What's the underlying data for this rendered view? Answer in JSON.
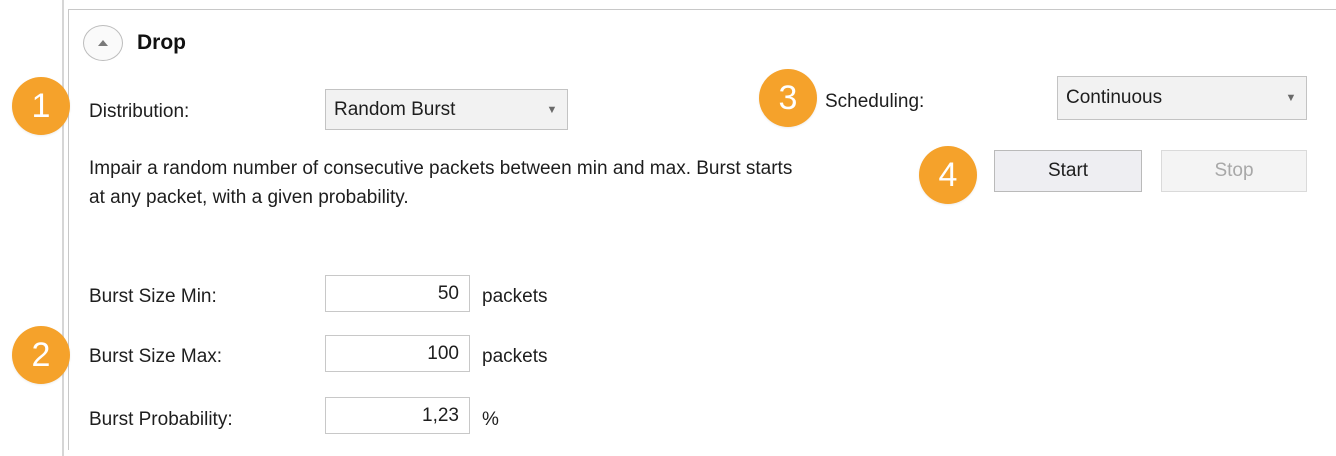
{
  "section": {
    "title": "Drop",
    "toggle_icon": "chevron-up-icon"
  },
  "distribution": {
    "label": "Distribution:",
    "value": "Random Burst"
  },
  "scheduling": {
    "label": "Scheduling:",
    "value": "Continuous"
  },
  "description": "Impair a random number of consecutive packets between min and max. Burst starts at any packet, with a given probability.",
  "fields": [
    {
      "label": "Burst Size Min:",
      "value": "50",
      "unit": "packets"
    },
    {
      "label": "Burst Size Max:",
      "value": "100",
      "unit": "packets"
    },
    {
      "label": "Burst Probability:",
      "value": "1,23",
      "unit": "%"
    }
  ],
  "buttons": {
    "start": "Start",
    "stop": "Stop"
  },
  "callouts": [
    "1",
    "2",
    "3",
    "4"
  ],
  "colors": {
    "callout": "#f5a22b",
    "disabled_text": "#a8a8a8"
  }
}
